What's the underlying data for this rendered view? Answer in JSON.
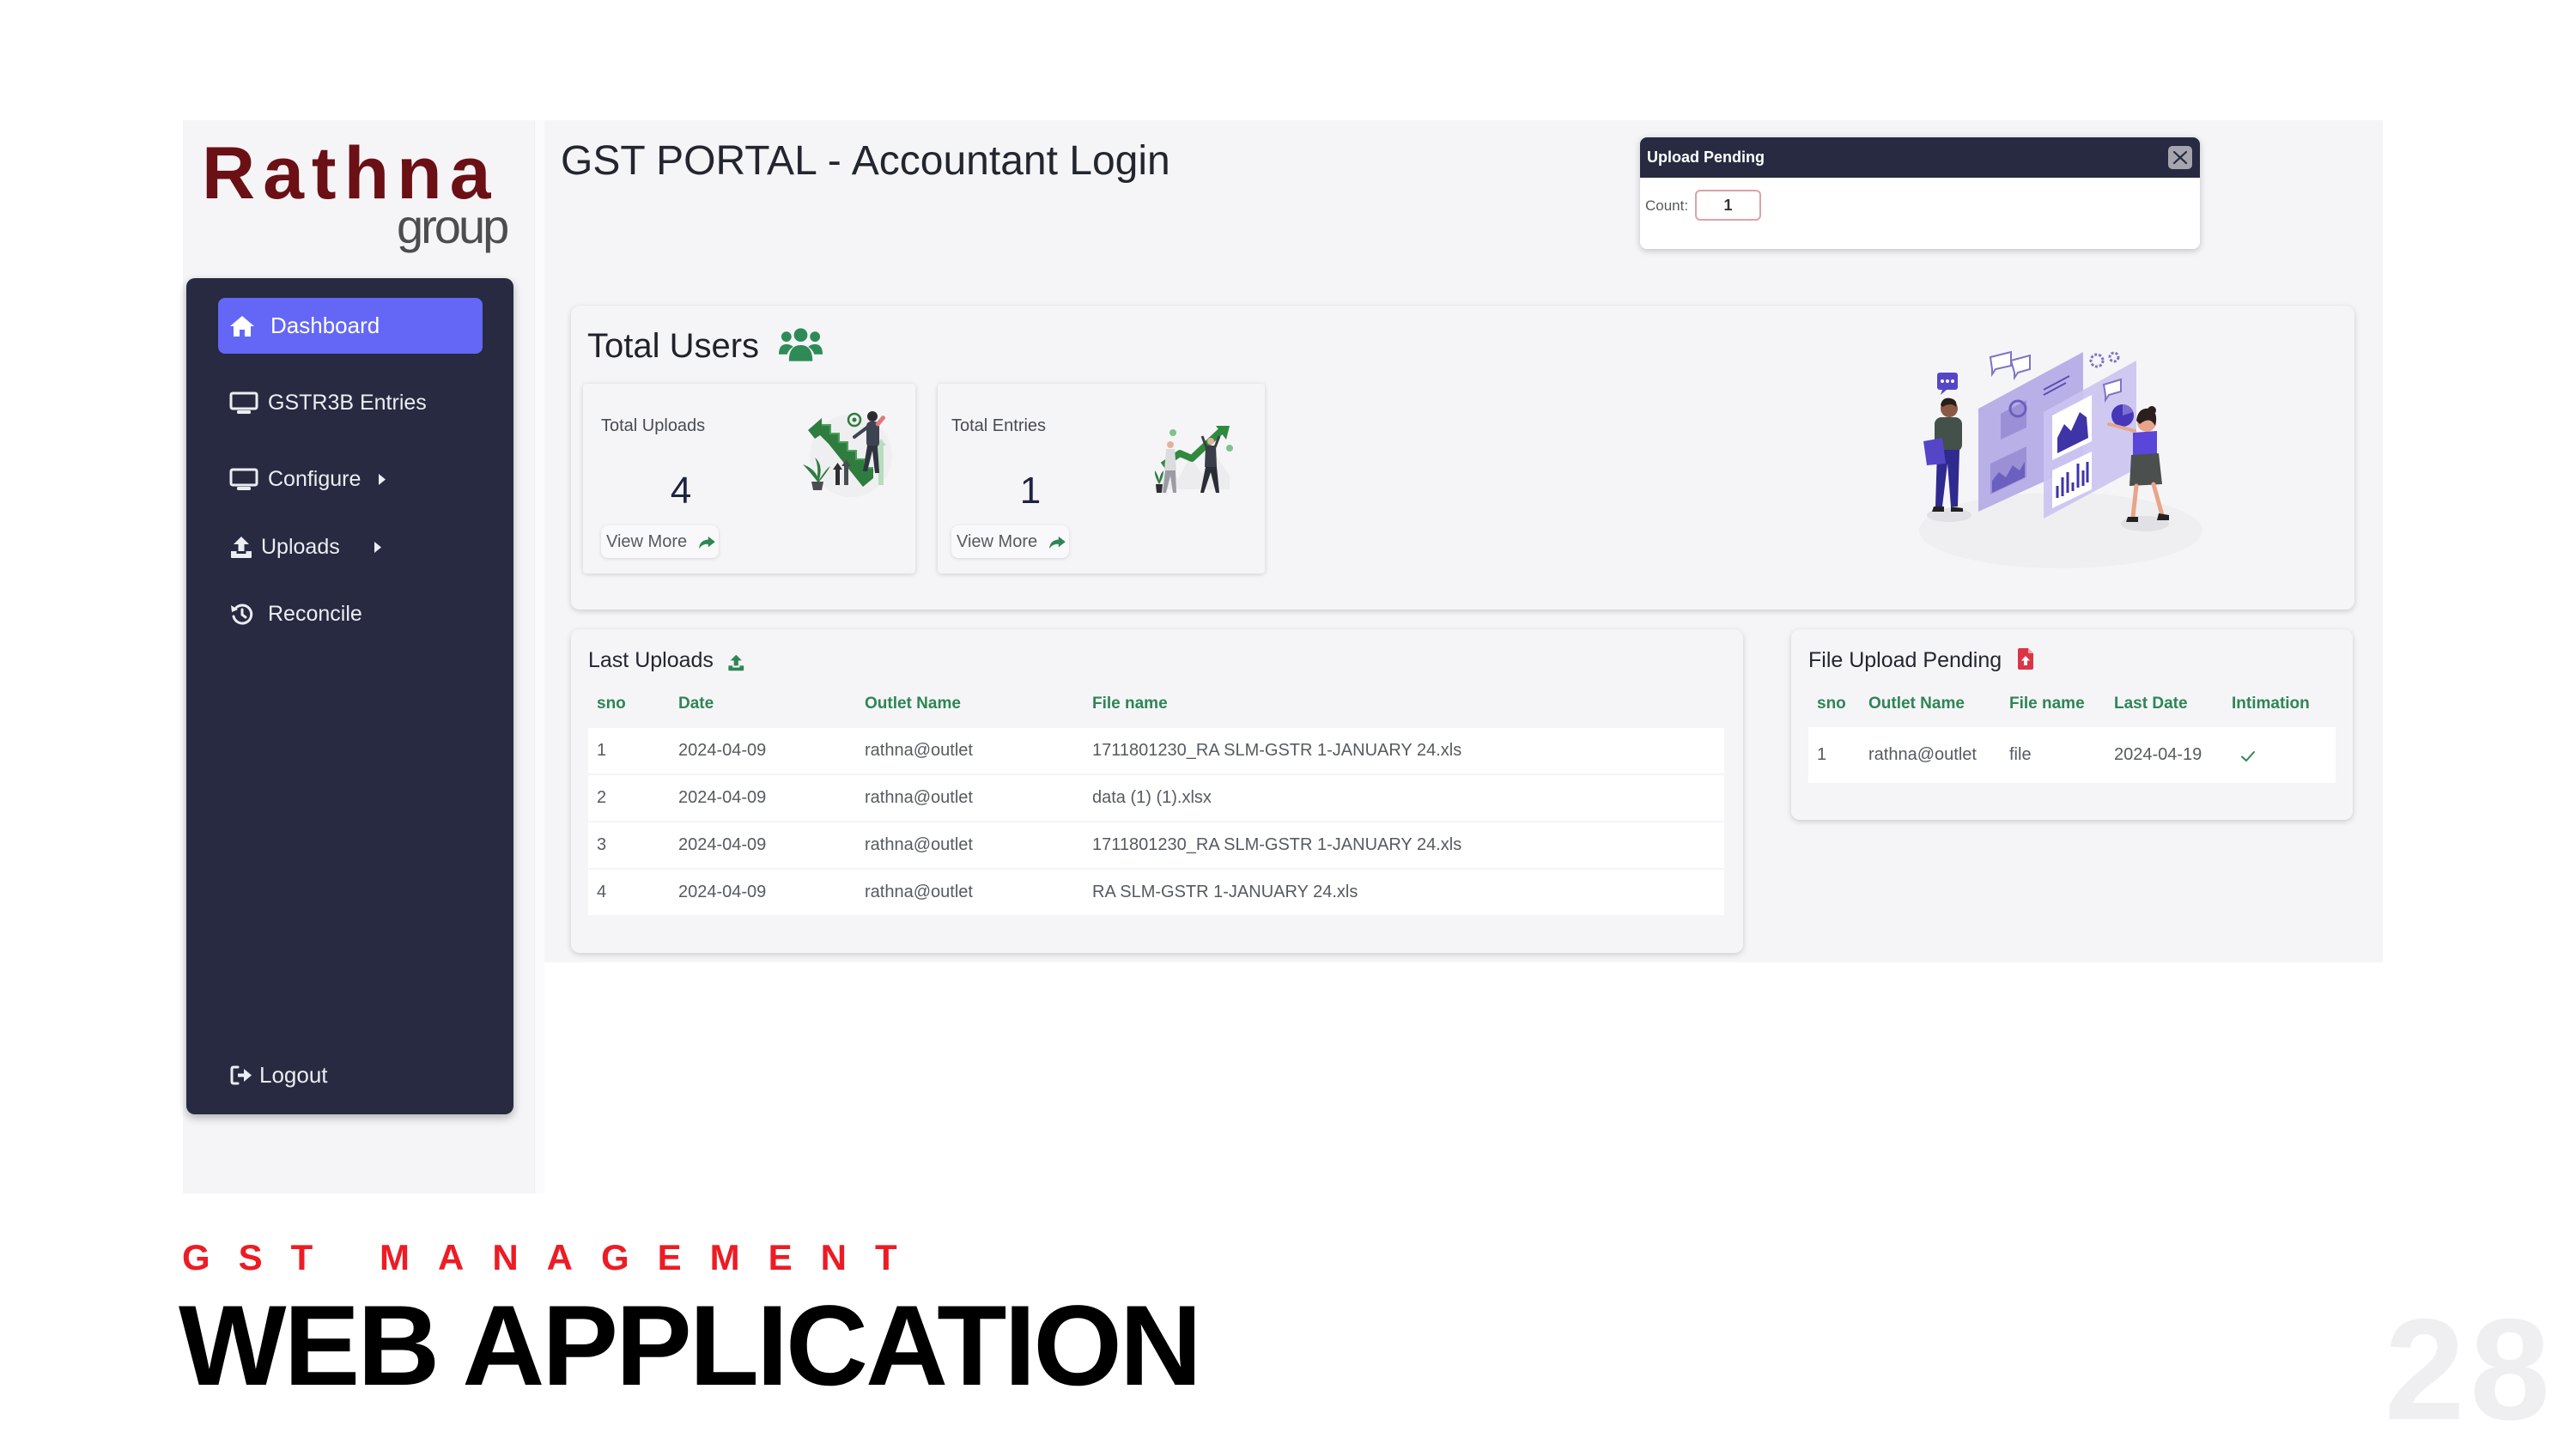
{
  "app": {
    "logo": {
      "brand": "Rathna",
      "tagline": "group"
    },
    "header": {
      "title": "GST PORTAL",
      "separator": "-",
      "subtitle": "Accountant Login"
    },
    "sidebar": {
      "items": [
        {
          "label": "Dashboard",
          "icon": "home-icon",
          "active": true
        },
        {
          "label": "GSTR3B Entries",
          "icon": "desktop-icon",
          "active": false
        },
        {
          "label": "Configure",
          "icon": "desktop-icon",
          "active": false,
          "submenu": true
        },
        {
          "label": "Uploads",
          "icon": "upload-icon",
          "active": false,
          "submenu": true
        },
        {
          "label": "Reconcile",
          "icon": "history-icon",
          "active": false
        }
      ],
      "logout": {
        "label": "Logout",
        "icon": "logout-icon"
      }
    },
    "upload_pending_popup": {
      "title": "Upload Pending",
      "count_label": "Count:",
      "count_value": "1",
      "close_icon": "close-icon"
    },
    "total_users": {
      "title": "Total Users",
      "icon": "users-icon",
      "stats": [
        {
          "label": "Total Uploads",
          "value": "4",
          "link_label": "View More",
          "link_icon": "share-icon"
        },
        {
          "label": "Total Entries",
          "value": "1",
          "link_label": "View More",
          "link_icon": "share-icon"
        }
      ]
    },
    "last_uploads": {
      "title": "Last Uploads",
      "icon": "upload-icon",
      "columns": [
        "sno",
        "Date",
        "Outlet Name",
        "File name"
      ],
      "rows": [
        {
          "sno": "1",
          "date": "2024-04-09",
          "outlet": "rathna@outlet",
          "file": "1711801230_RA SLM-GSTR 1-JANUARY 24.xls"
        },
        {
          "sno": "2",
          "date": "2024-04-09",
          "outlet": "rathna@outlet",
          "file": "data (1) (1).xlsx"
        },
        {
          "sno": "3",
          "date": "2024-04-09",
          "outlet": "rathna@outlet",
          "file": "1711801230_RA SLM-GSTR 1-JANUARY 24.xls"
        },
        {
          "sno": "4",
          "date": "2024-04-09",
          "outlet": "rathna@outlet",
          "file": "RA SLM-GSTR 1-JANUARY 24.xls"
        }
      ]
    },
    "file_upload_pending": {
      "title": "File Upload Pending",
      "icon": "file-upload-icon",
      "columns": [
        "sno",
        "Outlet Name",
        "File name",
        "Last Date",
        "Intimation"
      ],
      "rows": [
        {
          "sno": "1",
          "outlet": "rathna@outlet",
          "file": "file",
          "last_date": "2024-04-19",
          "intimation": "check-icon"
        }
      ]
    }
  },
  "slide": {
    "kicker": "GST MANAGEMENT",
    "title": "WEB APPLICATION",
    "page_number": "28"
  },
  "colors": {
    "sidebar_bg": "#272a40",
    "active_nav": "#6467f5",
    "accent_green": "#2e8555",
    "danger_red": "#dc3545",
    "logo_maroon": "#6b1014",
    "kicker_red": "#ed1c24",
    "content_bg": "#f5f5f8"
  }
}
